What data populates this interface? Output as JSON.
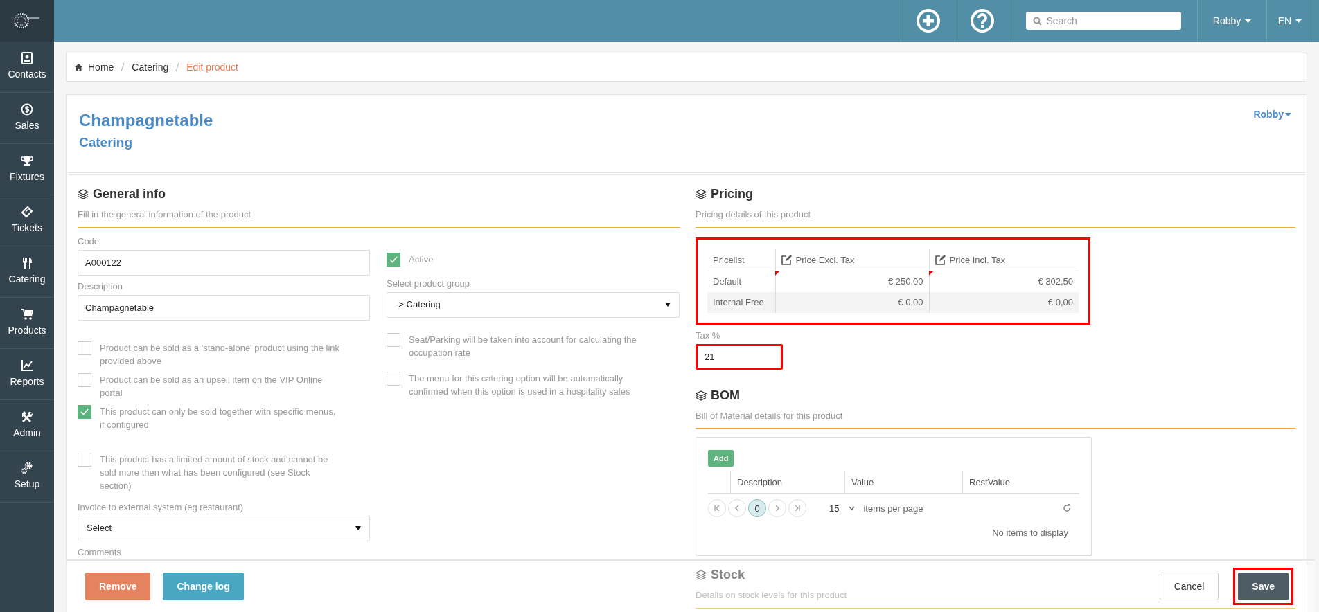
{
  "topbar": {
    "search": {
      "placeholder": "Search"
    },
    "user": "Robby",
    "language": "EN"
  },
  "sidebar": {
    "items": [
      {
        "label": "Contacts"
      },
      {
        "label": "Sales"
      },
      {
        "label": "Fixtures"
      },
      {
        "label": "Tickets"
      },
      {
        "label": "Catering"
      },
      {
        "label": "Products"
      },
      {
        "label": "Reports"
      },
      {
        "label": "Admin"
      },
      {
        "label": "Setup"
      }
    ]
  },
  "breadcrumb": [
    {
      "label": "Home",
      "current": false
    },
    {
      "label": "Catering",
      "current": false
    },
    {
      "label": "Edit product",
      "current": true
    }
  ],
  "header": {
    "title": "Champagnetable",
    "subtitle": "Catering",
    "owner": "Robby"
  },
  "general_info": {
    "title": "General info",
    "subtitle": "Fill in the general information of the product",
    "code": {
      "label": "Code",
      "value": "A000122"
    },
    "active": {
      "label": "Active",
      "checked": true
    },
    "description": {
      "label": "Description",
      "value": "Champagnetable"
    },
    "product_group": {
      "label": "Select product group",
      "value": "-> Catering"
    },
    "options_left": [
      {
        "label": "Product can be sold as a 'stand-alone' product using the link provided above",
        "checked": false
      },
      {
        "label": "Product can be sold as an upsell item on the VIP Online portal",
        "checked": false
      },
      {
        "label": "This product can only be sold together with specific menus, if configured",
        "checked": true
      },
      {
        "label": "This product has a limited amount of stock and cannot be sold more then what has been configured (see Stock section)",
        "checked": false
      }
    ],
    "options_right": [
      {
        "label": "Seat/Parking will be taken into account for calculating the occupation rate",
        "checked": false
      },
      {
        "label": "The menu for this catering option will be automatically confirmed when this option is used in a hospitality sales",
        "checked": false
      }
    ],
    "invoice": {
      "label": "Invoice to external system (eg restaurant)",
      "value": "Select"
    },
    "comments": {
      "label": "Comments"
    }
  },
  "pricing": {
    "title": "Pricing",
    "subtitle": "Pricing details of this product",
    "highlighted": true,
    "columns": [
      {
        "label": "Pricelist",
        "editable": false
      },
      {
        "label": "Price Excl. Tax",
        "editable": true
      },
      {
        "label": "Price Incl. Tax",
        "editable": true
      }
    ],
    "rows": [
      {
        "cells": [
          {
            "text": "Default",
            "changed": false
          },
          {
            "text": "€ 250,00",
            "changed": true
          },
          {
            "text": "€ 302,50",
            "changed": true
          }
        ]
      },
      {
        "cells": [
          {
            "text": "Internal Free",
            "changed": false
          },
          {
            "text": "€ 0,00",
            "changed": false
          },
          {
            "text": "€ 0,00",
            "changed": false
          }
        ]
      }
    ],
    "tax": {
      "label": "Tax %",
      "value": "21",
      "highlighted": true
    }
  },
  "bom": {
    "title": "BOM",
    "subtitle": "Bill of Material details for this product",
    "add_button": "Add",
    "columns": [
      "Description",
      "Value",
      "RestValue"
    ],
    "pager": {
      "page": "0",
      "page_size": "15",
      "page_size_label": "items per page"
    },
    "empty": "No items to display"
  },
  "stock": {
    "title": "Stock",
    "subtitle": "Details on stock levels for this product"
  },
  "actions": {
    "left": [
      {
        "label": "Remove",
        "kind": "danger",
        "highlighted": false
      },
      {
        "label": "Change log",
        "kind": "info",
        "highlighted": false
      }
    ],
    "right": [
      {
        "label": "Cancel",
        "kind": "default",
        "highlighted": false
      },
      {
        "label": "Save",
        "kind": "primary",
        "highlighted": true
      }
    ]
  }
}
